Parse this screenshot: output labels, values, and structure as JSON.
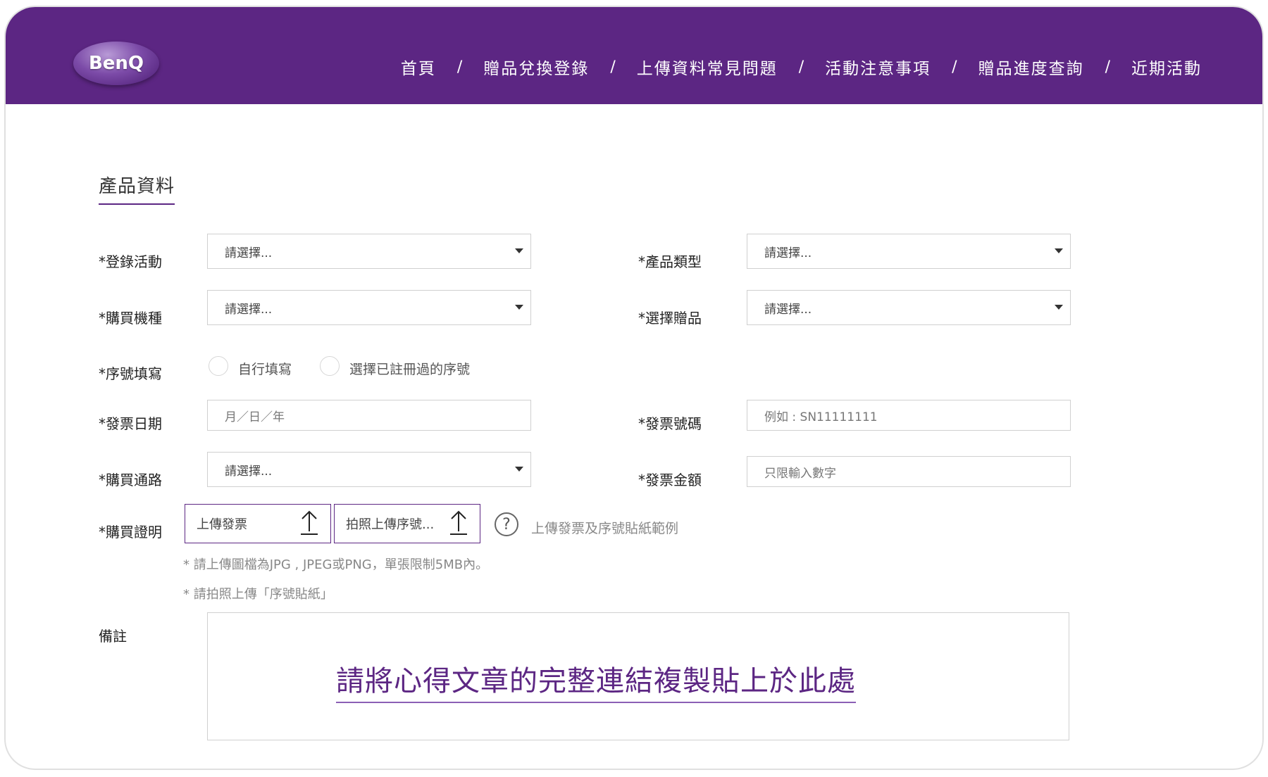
{
  "brand": {
    "logo_text": "BenQ"
  },
  "nav": {
    "items": [
      "首頁",
      "贈品兌換登錄",
      "上傳資料常見問題",
      "活動注意事項",
      "贈品進度查詢",
      "近期活動"
    ],
    "separator": "/"
  },
  "section": {
    "title": "產品資料"
  },
  "form": {
    "activity": {
      "label": "*登錄活動",
      "value": "請選擇..."
    },
    "product_type": {
      "label": "*產品類型",
      "value": "請選擇..."
    },
    "model": {
      "label": "*購買機種",
      "value": "請選擇..."
    },
    "gift": {
      "label": "*選擇贈品",
      "value": "請選擇..."
    },
    "serial": {
      "label": "*序號填寫",
      "option_manual": "自行填寫",
      "option_registered": "選擇已註冊過的序號"
    },
    "invoice_date": {
      "label": "*發票日期",
      "placeholder": "月／日／年"
    },
    "invoice_number": {
      "label": "*發票號碼",
      "placeholder": "例如 : SN11111111"
    },
    "channel": {
      "label": "*購買通路",
      "value": "請選擇..."
    },
    "invoice_amount": {
      "label": "*發票金額",
      "placeholder": "只限輸入數字"
    },
    "proof": {
      "label": "*購買證明",
      "upload_invoice": "上傳發票",
      "upload_serial": "拍照上傳序號...",
      "help_text": "上傳發票及序號貼紙範例",
      "note1": "* 請上傳圖檔為JPG , JPEG或PNG，單張限制5MB內。",
      "note2": "* 請拍照上傳「序號貼紙」"
    },
    "remark": {
      "label": "備註",
      "callout": "請將心得文章的完整連結複製貼上於此處"
    }
  },
  "colors": {
    "brand_purple": "#5c2683"
  }
}
